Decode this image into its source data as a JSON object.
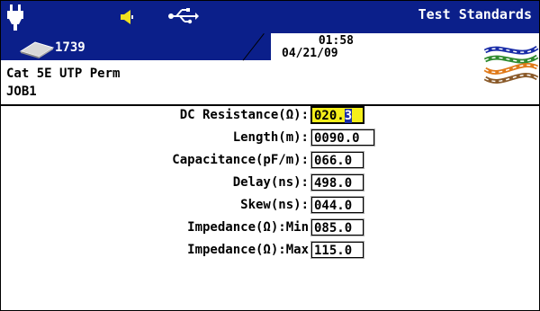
{
  "header": {
    "title": "Test Standards",
    "icons": [
      "plug-icon",
      "speaker-icon",
      "usb-icon",
      "tray-icon",
      "cable-icon"
    ],
    "count": "1739",
    "time": "01:58",
    "date": "04/21/09",
    "accent": "#0b1f8a"
  },
  "info": {
    "cable": "Cat 5E UTP Perm",
    "job": "JOB1"
  },
  "fields": [
    {
      "label": "DC Resistance(Ω):",
      "value": "020.",
      "cursor_char": "3",
      "focused": true
    },
    {
      "label": "Length(m):",
      "value": "0090.0"
    },
    {
      "label": "Capacitance(pF/m):",
      "value": "066.0"
    },
    {
      "label": "Delay(ns):",
      "value": "498.0"
    },
    {
      "label": "Skew(ns):",
      "value": "044.0"
    },
    {
      "label": "Impedance(Ω):Min",
      "value": "085.0"
    },
    {
      "label": "Impedance(Ω):Max",
      "value": "115.0"
    }
  ],
  "colors": {
    "focus_bg": "#f5ef1a",
    "cursor_bg": "#1a2da8"
  }
}
